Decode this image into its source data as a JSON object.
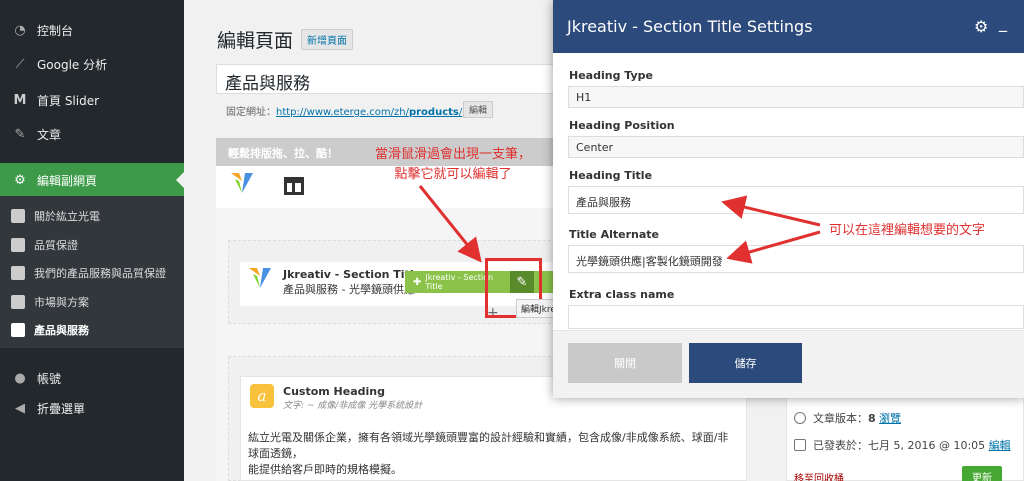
{
  "sidebar": {
    "items": [
      {
        "label": "控制台",
        "icon": "dashboard-icon"
      },
      {
        "label": "Google 分析",
        "icon": "analytics-icon"
      },
      {
        "label": "首頁 Slider",
        "icon": "slider-icon"
      },
      {
        "label": "文章",
        "icon": "pin-icon"
      },
      {
        "label": "編輯副網頁",
        "icon": "gear-icon"
      }
    ],
    "subitems": [
      "關於紘立光電",
      "品質保證",
      "我們的產品服務與品質保證",
      "市場與方案",
      "產品與服務"
    ],
    "bottom": [
      {
        "label": "帳號",
        "icon": "user-icon"
      },
      {
        "label": "折疊選單",
        "icon": "collapse-icon"
      }
    ]
  },
  "main": {
    "page_title": "編輯頁面",
    "add_new": "新增頁面",
    "post_title": "產品與服務",
    "permalink_label": "固定網址：",
    "permalink_prefix": "http://www.eterge.com/zh/",
    "permalink_slug": "products",
    "permalink_suffix": "/",
    "edit_label": "編輯",
    "vc_bar_label": "輕鬆排版拖、拉、酷！",
    "element1_title": "Jkreativ - Section Title",
    "element1_sub": "產品與服務 - 光學鏡頭供應",
    "green_bar_label": "Jkreativ - Section Title",
    "tooltip": "編輯Jkreativ - Section Title",
    "plus": "+",
    "element2_title": "Custom Heading",
    "element2_sub": "文字: ~ 成像/非成像 光學系統設計",
    "element2_icon_letter": "a",
    "element2_text_1": "紘立光電及關係企業，擁有各領域光學鏡頭豐富的設計經驗和實績，包含成像/非成像系統、球面/非球面透鏡，",
    "element2_text_2": "能提供給客戶即時的規格模擬。"
  },
  "annotations": {
    "hover_line1": "當滑鼠滑過會出現一支筆，",
    "hover_line2": "點擊它就可以編輯了",
    "edit_text": "可以在這裡編輯想要的文字"
  },
  "modal": {
    "title": "Jkreativ - Section Title Settings",
    "heading_type_label": "Heading Type",
    "heading_type_value": "H1",
    "heading_position_label": "Heading Position",
    "heading_position_value": "Center",
    "heading_title_label": "Heading Title",
    "heading_title_value": "產品與服務",
    "title_alternate_label": "Title Alternate",
    "title_alternate_value": "光學鏡頭供應|客製化鏡頭開發",
    "extra_class_label": "Extra class name",
    "extra_class_value": "",
    "close_label": "關閉",
    "save_label": "儲存"
  },
  "publish": {
    "revisions_label": "文章版本：",
    "revisions_count": "8",
    "revisions_link": "瀏覽",
    "published_label": "已發表於：七月 5, 2016 @ 10:05",
    "published_edit": "編輯",
    "trash": "移至回收桶",
    "update": "更新"
  },
  "colors": {
    "accent": "#2c4a7b",
    "active_menu": "#3c9a49",
    "annotation": "#e03030",
    "vc_green": "#8bc34a"
  }
}
